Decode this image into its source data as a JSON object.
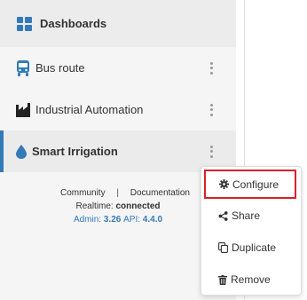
{
  "sidebar": {
    "header": {
      "label": "Dashboards",
      "icon": "dashboard-grid-icon"
    },
    "items": [
      {
        "label": "Bus route",
        "icon": "bus-icon"
      },
      {
        "label": "Industrial Automation",
        "icon": "factory-icon"
      },
      {
        "label": "Smart Irrigation",
        "icon": "water-drop-icon",
        "active": true
      }
    ]
  },
  "footer": {
    "community": "Community",
    "separator": "|",
    "documentation": "Documentation",
    "realtime_label": "Realtime:",
    "realtime_status": "connected",
    "admin_label": "Admin:",
    "admin_version": "3.26",
    "api_label": "API:",
    "api_version": "4.4.0"
  },
  "context_menu": {
    "items": [
      {
        "label": "Configure",
        "icon": "gear-icon"
      },
      {
        "label": "Share",
        "icon": "share-icon"
      },
      {
        "label": "Duplicate",
        "icon": "copy-icon"
      },
      {
        "label": "Remove",
        "icon": "trash-icon"
      }
    ]
  },
  "colors": {
    "accent": "#337ab7",
    "highlight_border": "#d9202b",
    "sidebar_bg": "#f5f5f5"
  }
}
